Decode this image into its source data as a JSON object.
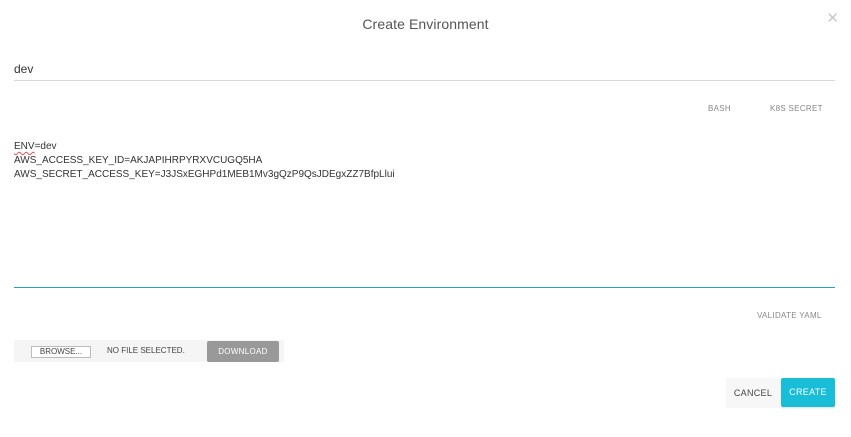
{
  "dialog": {
    "title": "Create Environment",
    "close_icon": "close-icon",
    "close_glyph": "✕"
  },
  "name_field": {
    "value": "dev"
  },
  "tabs": [
    {
      "label": "BASH"
    },
    {
      "label": "K8S SECRET"
    }
  ],
  "editor": {
    "lines": [
      {
        "key": "ENV",
        "rest": "=dev"
      },
      {
        "key": "",
        "rest": "AWS_ACCESS_KEY_ID=AKJAPIHRPYRXVCUGQ5HA"
      },
      {
        "key": "",
        "rest": "AWS_SECRET_ACCESS_KEY=J3JSxEGHPd1MEB1Mv3gQzP9QsJDEgxZZ7BfpLlui"
      }
    ],
    "underline_color": "#2aa1c0"
  },
  "validate_label": "VALIDATE YAML",
  "file": {
    "browse_label": "BROWSE...",
    "status": "NO FILE SELECTED.",
    "download_label": "DOWNLOAD"
  },
  "actions": {
    "cancel_label": "CANCEL",
    "create_label": "CREATE",
    "accent_color": "#18bed8"
  }
}
